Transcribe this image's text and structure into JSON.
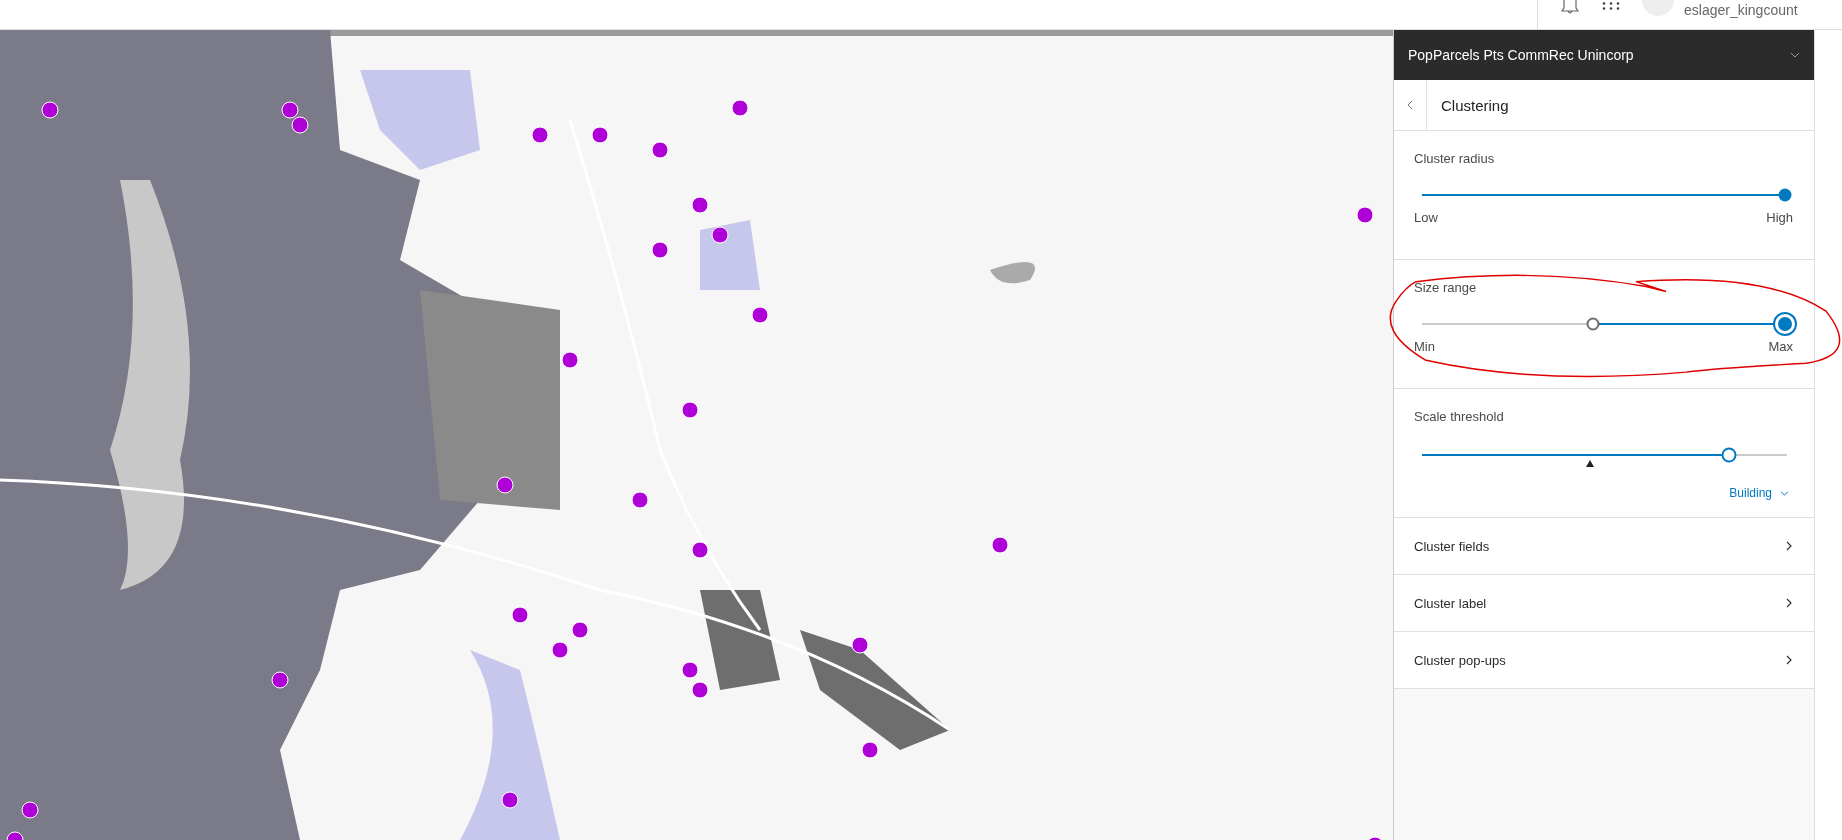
{
  "top_bar": {
    "username": "eslager_kingcount"
  },
  "panel": {
    "layer_title": "PopParcels Pts CommRec Unincorp",
    "page_title": "Clustering",
    "cluster_radius": {
      "label": "Cluster radius",
      "level": 1,
      "min_label": "Low",
      "max_label": "High"
    },
    "size_range": {
      "label": "Size range",
      "low": {
        "level": 0.47
      },
      "high": {
        "level": 1
      },
      "min_label": "Min",
      "max_label": "Max"
    },
    "scale_threshold": {
      "label": "Scale threshold",
      "level": 0.84,
      "marker": {
        "level": 0.46
      },
      "dropdown": "Building"
    },
    "links": [
      {
        "label": "Cluster fields"
      },
      {
        "label": "Cluster label"
      },
      {
        "label": "Cluster pop-ups"
      }
    ]
  }
}
